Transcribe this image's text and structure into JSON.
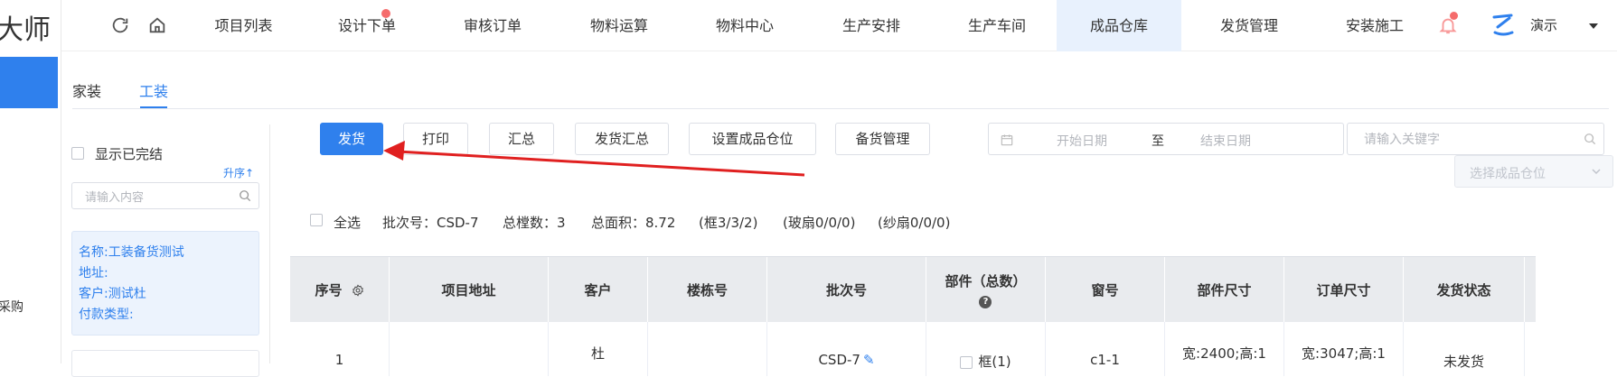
{
  "sidebar": {
    "brand": "大师",
    "nav_item": "采购"
  },
  "topnav": {
    "items": [
      {
        "label": "项目列表"
      },
      {
        "label": "设计下单"
      },
      {
        "label": "审核订单"
      },
      {
        "label": "物料运算"
      },
      {
        "label": "物料中心"
      },
      {
        "label": "生产安排"
      },
      {
        "label": "生产车间"
      },
      {
        "label": "成品仓库"
      },
      {
        "label": "发货管理"
      },
      {
        "label": "安装施工"
      }
    ],
    "user_name": "演示",
    "accent": "#2f80ed",
    "active_bg": "#e8f1fd",
    "dot_color": "#f56c6c"
  },
  "tabs": [
    {
      "label": "家装"
    },
    {
      "label": "工装"
    }
  ],
  "filter": {
    "show_completed": "显示已完结",
    "sort": "升序↑",
    "search_placeholder": "请输入内容",
    "card": {
      "name": "名称:工装备货测试",
      "address": "地址:",
      "customer": "客户:测试杜",
      "payment": "付款类型:"
    }
  },
  "toolbar": {
    "ship": "发货",
    "print": "打印",
    "summary": "汇总",
    "ship_summary": "发货汇总",
    "set_location": "设置成品仓位",
    "stock_manage": "备货管理",
    "start_date": "开始日期",
    "to": "至",
    "end_date": "结束日期",
    "keyword_placeholder": "请输入关键字",
    "select_location": "选择成品仓位"
  },
  "summary": {
    "select_all": "全选",
    "batch": "批次号：CSD-7",
    "total_floors": "总樘数：3",
    "total_area": "总面积：8.72",
    "frame": "(框3/3/2)",
    "glass_sash": "(玻扇0/0/0)",
    "screen_sash": "(纱扇0/0/0)"
  },
  "table": {
    "headers": [
      "序号",
      "项目地址",
      "客户",
      "楼栋号",
      "批次号",
      "部件（总数）",
      "窗号",
      "部件尺寸",
      "订单尺寸",
      "发货状态"
    ],
    "row": {
      "index": "1",
      "address": "",
      "customer": "杜",
      "building": "",
      "batch": "CSD-7",
      "part": "框(1)",
      "window_no": "c1-1",
      "part_size": "宽:2400;高:1",
      "order_size": "宽:3047;高:1",
      "status": "未发货"
    }
  }
}
